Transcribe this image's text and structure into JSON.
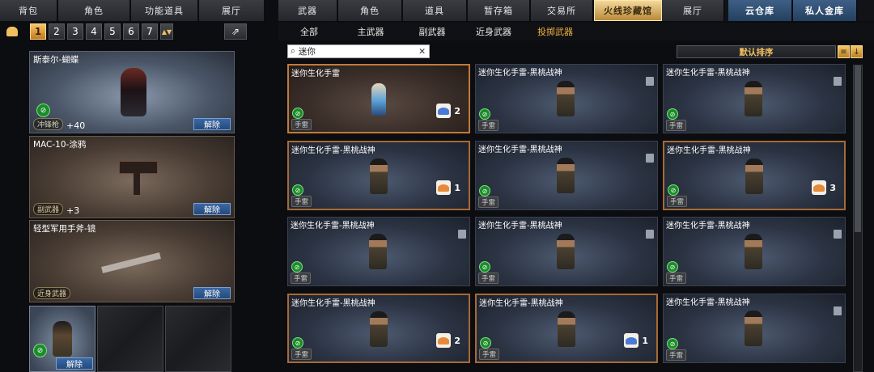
{
  "left_tabs": [
    "背包",
    "角色",
    "功能道具",
    "展厅"
  ],
  "right_tabs": [
    "武器",
    "角色",
    "道具",
    "暂存箱",
    "交易所",
    "火线珍藏馆",
    "展厅",
    "云仓库",
    "私人金库"
  ],
  "pages": [
    "1",
    "2",
    "3",
    "4",
    "5",
    "6",
    "7"
  ],
  "sub_tabs": [
    "全部",
    "主武器",
    "副武器",
    "近身武器",
    "投掷武器"
  ],
  "search": {
    "value": "迷你"
  },
  "sort_label": "默认排序",
  "equipped": [
    {
      "name": "斯泰尔-蝴蝶",
      "category": "冲锋枪",
      "bonus": "+40",
      "button": "解除"
    },
    {
      "name": "MAC-10-涂鸦",
      "category": "副武器",
      "bonus": "+3",
      "button": "解除"
    },
    {
      "name": "轻型军用手斧-镜",
      "category": "近身武器",
      "bonus": "",
      "button": "解除"
    }
  ],
  "small_slot_button": "解除",
  "items": [
    {
      "name": "迷你生化手雷",
      "tag": "手雷",
      "count": "2",
      "icon": "blue"
    },
    {
      "name": "迷你生化手雷-黑桃战神",
      "tag": "手雷",
      "count": "",
      "icon": ""
    },
    {
      "name": "迷你生化手雷-黑桃战神",
      "tag": "手雷",
      "count": "",
      "icon": ""
    },
    {
      "name": "迷你生化手雷-黑桃战神",
      "tag": "手雷",
      "count": "1",
      "icon": "orange"
    },
    {
      "name": "迷你生化手雷-黑桃战神",
      "tag": "手雷",
      "count": "",
      "icon": ""
    },
    {
      "name": "迷你生化手雷-黑桃战神",
      "tag": "手雷",
      "count": "3",
      "icon": "orange"
    },
    {
      "name": "迷你生化手雷-黑桃战神",
      "tag": "手雷",
      "count": "",
      "icon": ""
    },
    {
      "name": "迷你生化手雷-黑桃战神",
      "tag": "手雷",
      "count": "",
      "icon": ""
    },
    {
      "name": "迷你生化手雷-黑桃战神",
      "tag": "手雷",
      "count": "",
      "icon": ""
    },
    {
      "name": "迷你生化手雷-黑桃战神",
      "tag": "手雷",
      "count": "2",
      "icon": "orange"
    },
    {
      "name": "迷你生化手雷-黑桃战神",
      "tag": "手雷",
      "count": "1",
      "icon": "blue"
    },
    {
      "name": "迷你生化手雷-黑桃战神",
      "tag": "手雷",
      "count": "",
      "icon": ""
    }
  ]
}
